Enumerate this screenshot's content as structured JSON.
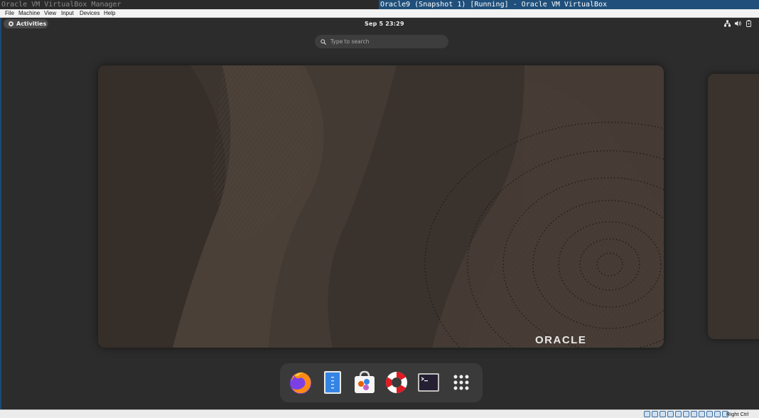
{
  "host_titlebar": {
    "manager_title": "Oracle VM VirtualBox Manager",
    "vm_title": "Oracle9 (Snapshot 1) [Running] - Oracle VM VirtualBox"
  },
  "menubar": {
    "items": [
      "File",
      "Machine",
      "View",
      "Input",
      "Devices",
      "Help"
    ]
  },
  "guest": {
    "activities_label": "Activities",
    "clock": "Sep 5  23:29",
    "search_placeholder": "Type to search",
    "wallpaper_logo": "ORACLE",
    "system_icons": [
      "network-icon",
      "volume-icon",
      "battery-icon"
    ],
    "dock": [
      {
        "name": "firefox",
        "icon": "firefox-icon"
      },
      {
        "name": "files",
        "icon": "files-icon"
      },
      {
        "name": "software",
        "icon": "software-store-icon"
      },
      {
        "name": "help",
        "icon": "help-lifebuoy-icon"
      },
      {
        "name": "terminal",
        "icon": "terminal-icon"
      },
      {
        "name": "show-apps",
        "icon": "app-grid-icon"
      }
    ]
  },
  "statusbar": {
    "host_key": "Right Ctrl"
  },
  "colors": {
    "titlebar_active": "#1f4f7a",
    "guest_bg": "#2c2c2c",
    "dock_bg": "#3a3a3a"
  }
}
